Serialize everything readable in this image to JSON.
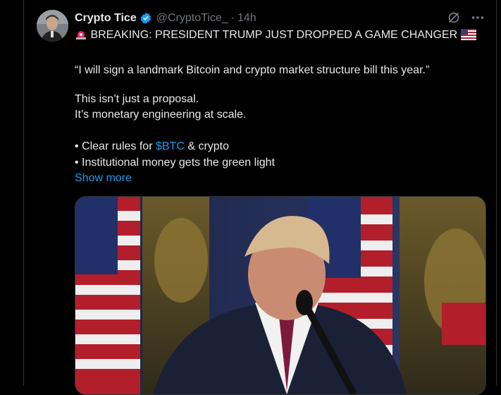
{
  "tweet": {
    "display_name": "Crypto Tice",
    "handle": "@CryptoTice_",
    "separator": "·",
    "time": "14h",
    "headline": "BREAKING: PRESIDENT TRUMP JUST DROPPED A GAME CHANGER",
    "quote": "“I will sign a landmark Bitcoin and crypto market structure bill this year.”",
    "line3": "This isn’t just a proposal.",
    "line4": "It’s monetary engineering at scale.",
    "bullet1_prefix": "• Clear rules for ",
    "bullet1_cashtag": "$BTC",
    "bullet1_suffix": " & crypto",
    "bullet2": "• Institutional money gets the green light",
    "show_more": "Show more"
  },
  "icons": {
    "verified": "verified-badge-icon",
    "grok": "grok-icon",
    "more": "more-icon",
    "siren": "siren-emoji-icon",
    "flag": "us-flag-emoji-icon"
  },
  "colors": {
    "background": "#000000",
    "text": "#e7e9ea",
    "muted": "#71767b",
    "link": "#1d9bf0",
    "border": "#2f3336"
  }
}
